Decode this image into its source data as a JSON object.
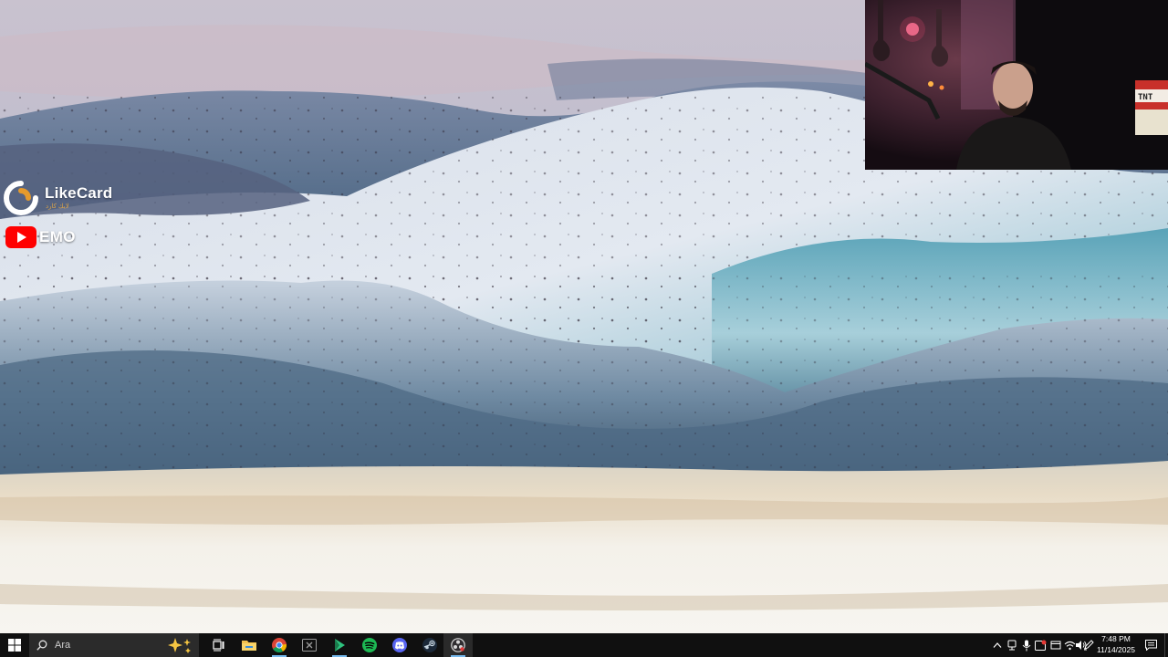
{
  "desktop": {
    "wallpaper": "inverted desert dunes landscape",
    "palette": {
      "sky": "#c8c3d3",
      "dune_light": "#dce4ee",
      "dune_shadow": "#3f5a73",
      "teal": "#3d8ea5",
      "ground": "#f1ebe0"
    }
  },
  "overlays": {
    "likecard": {
      "brand": "LikeCard",
      "tagline": "لايك كارد",
      "accent": "#e59a2c"
    },
    "youtube": {
      "channel": "EMO",
      "accent": "#ff0000"
    },
    "webcam": {
      "sign_text": "TNT"
    }
  },
  "taskbar": {
    "search": {
      "placeholder": "Ara"
    },
    "apps": [
      {
        "name": "task-view-icon"
      },
      {
        "name": "file-explorer-icon"
      },
      {
        "name": "chrome-icon"
      },
      {
        "name": "xbox-icon"
      },
      {
        "name": "game-launcher-icon"
      },
      {
        "name": "spotify-icon"
      },
      {
        "name": "discord-icon"
      },
      {
        "name": "steam-icon"
      },
      {
        "name": "obs-icon"
      }
    ],
    "tray": {
      "icons": [
        "chevron-up-icon",
        "network-adapter-icon",
        "microphone-icon",
        "record-icon",
        "security-icon",
        "wifi-icon",
        "volume-icon",
        "pen-icon"
      ]
    },
    "clock": {
      "time": "7:48 PM",
      "date": "11/14/2025"
    }
  }
}
